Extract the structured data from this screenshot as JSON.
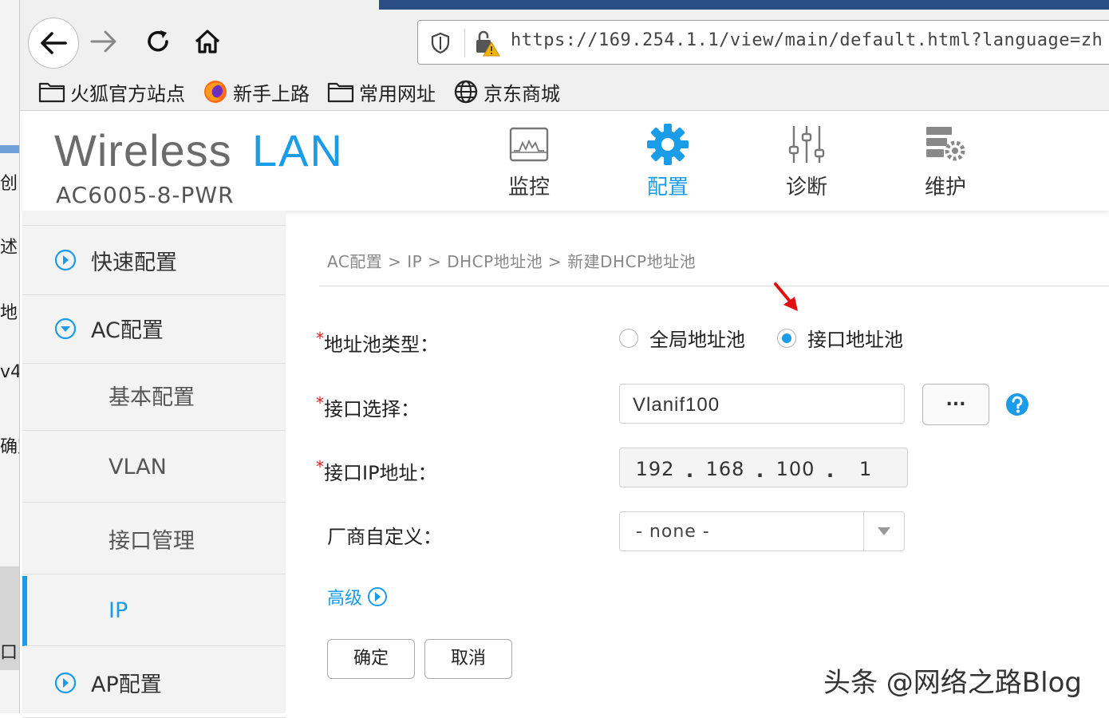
{
  "background_window": {
    "fragments": [
      "创",
      "述",
      "地",
      "v4",
      "确定",
      "口"
    ]
  },
  "browser": {
    "url": "https://169.254.1.1/view/main/default.html?language=zh",
    "bookmarks": [
      {
        "label": "火狐官方站点",
        "icon": "folder-icon"
      },
      {
        "label": "新手上路",
        "icon": "firefox-icon"
      },
      {
        "label": "常用网址",
        "icon": "folder-icon"
      },
      {
        "label": "京东商城",
        "icon": "globe-icon"
      }
    ]
  },
  "header": {
    "brand_part1": "Wireless",
    "brand_part2": "LAN",
    "model": "AC6005-8-PWR",
    "nav": [
      {
        "label": "监控",
        "icon": "monitor-icon",
        "active": false
      },
      {
        "label": "配置",
        "icon": "gear-icon",
        "active": true
      },
      {
        "label": "诊断",
        "icon": "sliders-icon",
        "active": false
      },
      {
        "label": "维护",
        "icon": "server-gear-icon",
        "active": false
      }
    ]
  },
  "sidebar": {
    "items": [
      {
        "label": "快速配置",
        "icon": "chevron-right-circle-icon"
      },
      {
        "label": "AC配置",
        "icon": "chevron-down-circle-icon"
      },
      {
        "label": "基本配置"
      },
      {
        "label": "VLAN"
      },
      {
        "label": "接口管理"
      },
      {
        "label": "IP",
        "active": true
      },
      {
        "label": "AP配置",
        "icon": "chevron-right-circle-icon"
      }
    ]
  },
  "main": {
    "breadcrumb": "AC配置 > IP > DHCP地址池 > 新建DHCP地址池",
    "pool_type_label": "地址池类型：",
    "pool_type_options": [
      "全局地址池",
      "接口地址池"
    ],
    "pool_type_selected": "接口地址池",
    "iface_label": "接口选择：",
    "iface_value": "Vlanif100",
    "browse_label": "...",
    "ip_label": "接口IP地址：",
    "ip_octets": [
      "192",
      "168",
      "100",
      "1"
    ],
    "vendor_label": "厂商自定义：",
    "vendor_value": "- none -",
    "advanced_label": "高级",
    "ok_label": "确定",
    "cancel_label": "取消",
    "required_mark": "*"
  },
  "colors": {
    "accent": "#1a9ce8",
    "required": "#e02020",
    "arrow": "#e01010"
  },
  "watermark": "头条 @网络之路Blog"
}
